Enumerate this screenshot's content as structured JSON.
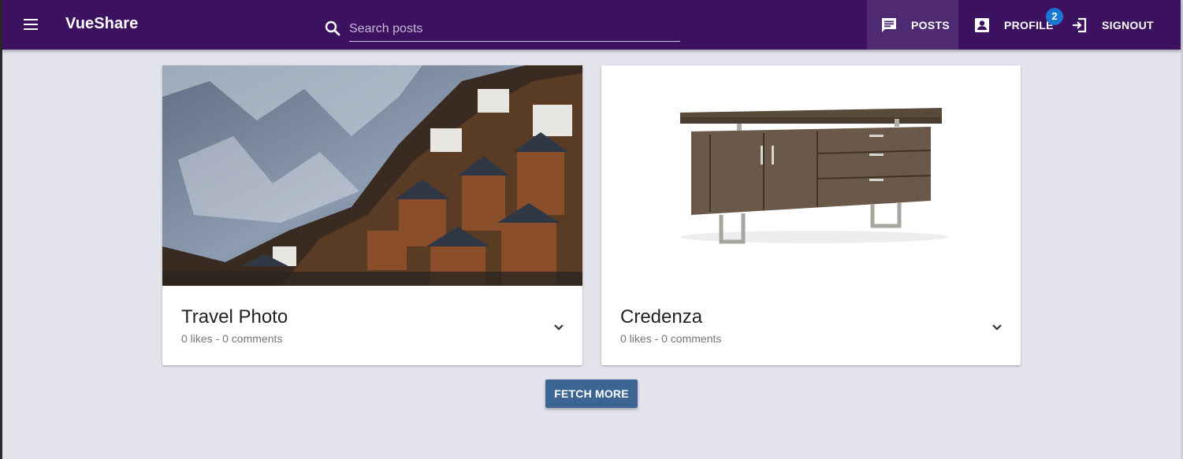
{
  "app": {
    "title": "VueShare"
  },
  "search": {
    "placeholder": "Search posts",
    "value": ""
  },
  "nav": {
    "posts_label": "POSTS",
    "profile_label": "PROFILE",
    "profile_badge": "2",
    "signout_label": "SIGNOUT"
  },
  "posts": [
    {
      "title": "Travel Photo",
      "meta": "0 likes - 0 comments"
    },
    {
      "title": "Credenza",
      "meta": "0 likes - 0 comments"
    }
  ],
  "actions": {
    "fetch_more_label": "FETCH MORE"
  },
  "colors": {
    "toolbar": "#3b1160",
    "toolbar_active": "#4d2a72",
    "badge": "#1976d2",
    "fetch_button": "#3c6593",
    "background": "#e3e3ec"
  },
  "icons": [
    "menu-icon",
    "search-icon",
    "message-icon",
    "account-box-icon",
    "exit-icon",
    "chevron-down-icon"
  ]
}
